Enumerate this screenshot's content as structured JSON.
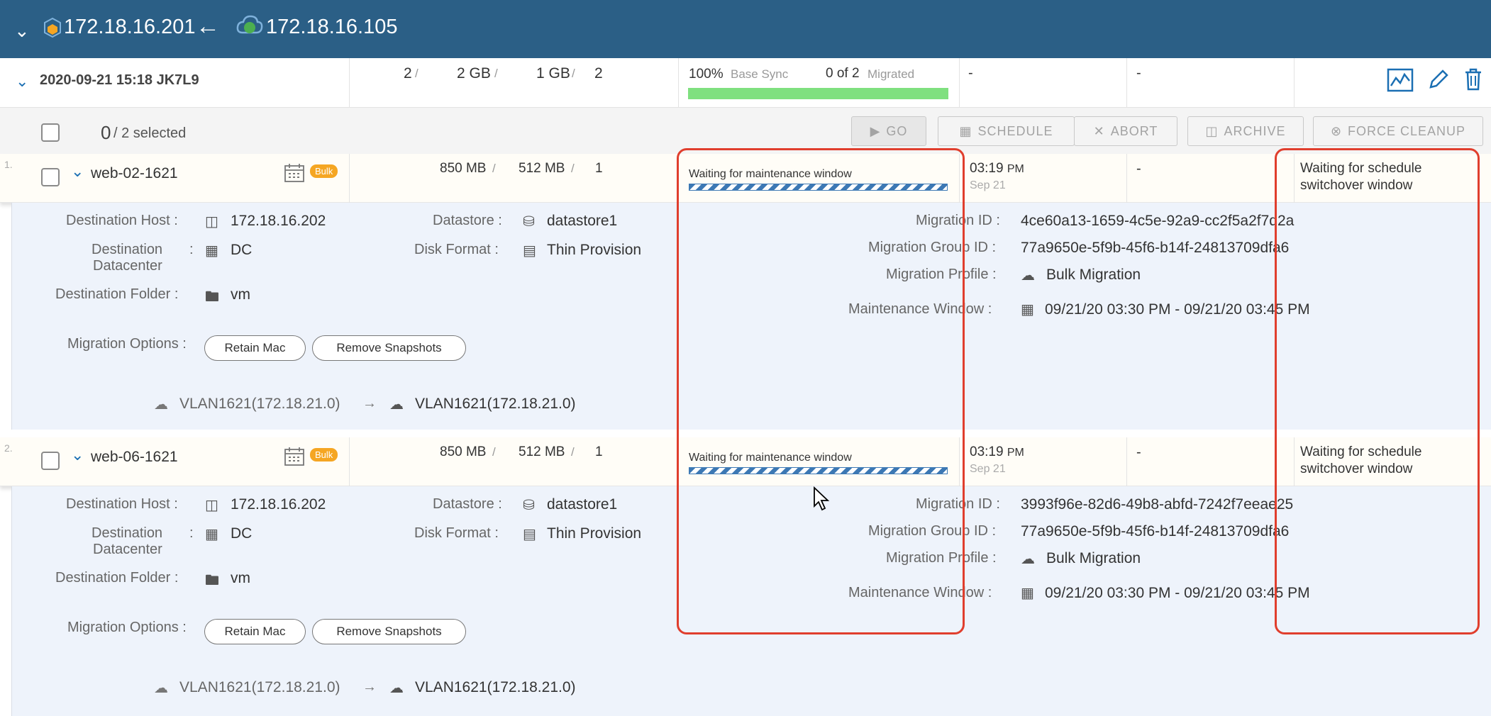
{
  "topbar": {
    "source_ip": "172.18.16.201",
    "dest_ip": "172.18.16.105"
  },
  "group": {
    "name": "2020-09-21 15:18 JK7L9",
    "vms": "2",
    "storage": "2 GB",
    "memory": "1 GB",
    "vcpu": "2",
    "progress": "100%",
    "phase": "Base Sync",
    "migrated_count": "0 of 2",
    "migrated_label": "Migrated",
    "col1": "-",
    "col2": "-"
  },
  "toolbar": {
    "selected_count": "0",
    "selected_total": "/ 2 selected",
    "go": "GO",
    "schedule": "SCHEDULE",
    "abort": "ABORT",
    "archive": "ARCHIVE",
    "force_cleanup": "FORCE CLEANUP"
  },
  "labels": {
    "dest_host": "Destination Host :",
    "dest_dc1": "Destination",
    "dest_dc2": "Datacenter",
    "colon": ":",
    "dest_folder": "Destination Folder :",
    "datastore": "Datastore :",
    "disk_format": "Disk Format :",
    "migration_options": "Migration Options :",
    "migration_id": "Migration ID :",
    "migration_group_id": "Migration Group ID :",
    "migration_profile": "Migration Profile :",
    "maintenance_window": "Maintenance Window :",
    "retain_mac": "Retain Mac",
    "remove_snapshots": "Remove Snapshots"
  },
  "vms": [
    {
      "index": "1.",
      "name": "web-02-1621",
      "badge": "Bulk",
      "storage": "850 MB",
      "memory": "512 MB",
      "vcpu": "1",
      "progress_text": "Waiting for maintenance window",
      "time": "03:19",
      "ampm": "PM",
      "date": "Sep 21",
      "col2": "-",
      "status1": "Waiting for schedule",
      "status2": "switchover window",
      "dest_host": "172.18.16.202",
      "dest_dc": "DC",
      "dest_folder": "vm",
      "datastore": "datastore1",
      "disk_format": "Thin Provision",
      "migration_id": "4ce60a13-1659-4c5e-92a9-cc2f5a2f7d2a",
      "migration_group_id": "77a9650e-5f9b-45f6-b14f-24813709dfa6",
      "migration_profile": "Bulk Migration",
      "maintenance_window": "09/21/20 03:30 PM - 09/21/20 03:45 PM",
      "src_net": "VLAN1621(172.18.21.0)",
      "dst_net": "VLAN1621(172.18.21.0)"
    },
    {
      "index": "2.",
      "name": "web-06-1621",
      "badge": "Bulk",
      "storage": "850 MB",
      "memory": "512 MB",
      "vcpu": "1",
      "progress_text": "Waiting for maintenance window",
      "time": "03:19",
      "ampm": "PM",
      "date": "Sep 21",
      "col2": "-",
      "status1": "Waiting for schedule",
      "status2": "switchover window",
      "dest_host": "172.18.16.202",
      "dest_dc": "DC",
      "dest_folder": "vm",
      "datastore": "datastore1",
      "disk_format": "Thin Provision",
      "migration_id": "3993f96e-82d6-49b8-abfd-7242f7eeae25",
      "migration_group_id": "77a9650e-5f9b-45f6-b14f-24813709dfa6",
      "migration_profile": "Bulk Migration",
      "maintenance_window": "09/21/20 03:30 PM - 09/21/20 03:45 PM",
      "src_net": "VLAN1621(172.18.21.0)",
      "dst_net": "VLAN1621(172.18.21.0)"
    }
  ],
  "icons": [
    "chevron-down-icon",
    "site-icon",
    "arrow-left-icon",
    "cloud-site-icon",
    "chart-icon",
    "pencil-icon",
    "trash-icon",
    "calendar-icon",
    "server-icon",
    "building-icon",
    "folder-icon",
    "database-icon",
    "disk-icon",
    "cloud-icon",
    "network-icon"
  ],
  "colors": {
    "topbar": "#2b5f86",
    "accent": "#1b6fb3",
    "bulk_badge": "#f5a623",
    "highlight": "#e03e2d",
    "progress": "#7fe07f"
  }
}
